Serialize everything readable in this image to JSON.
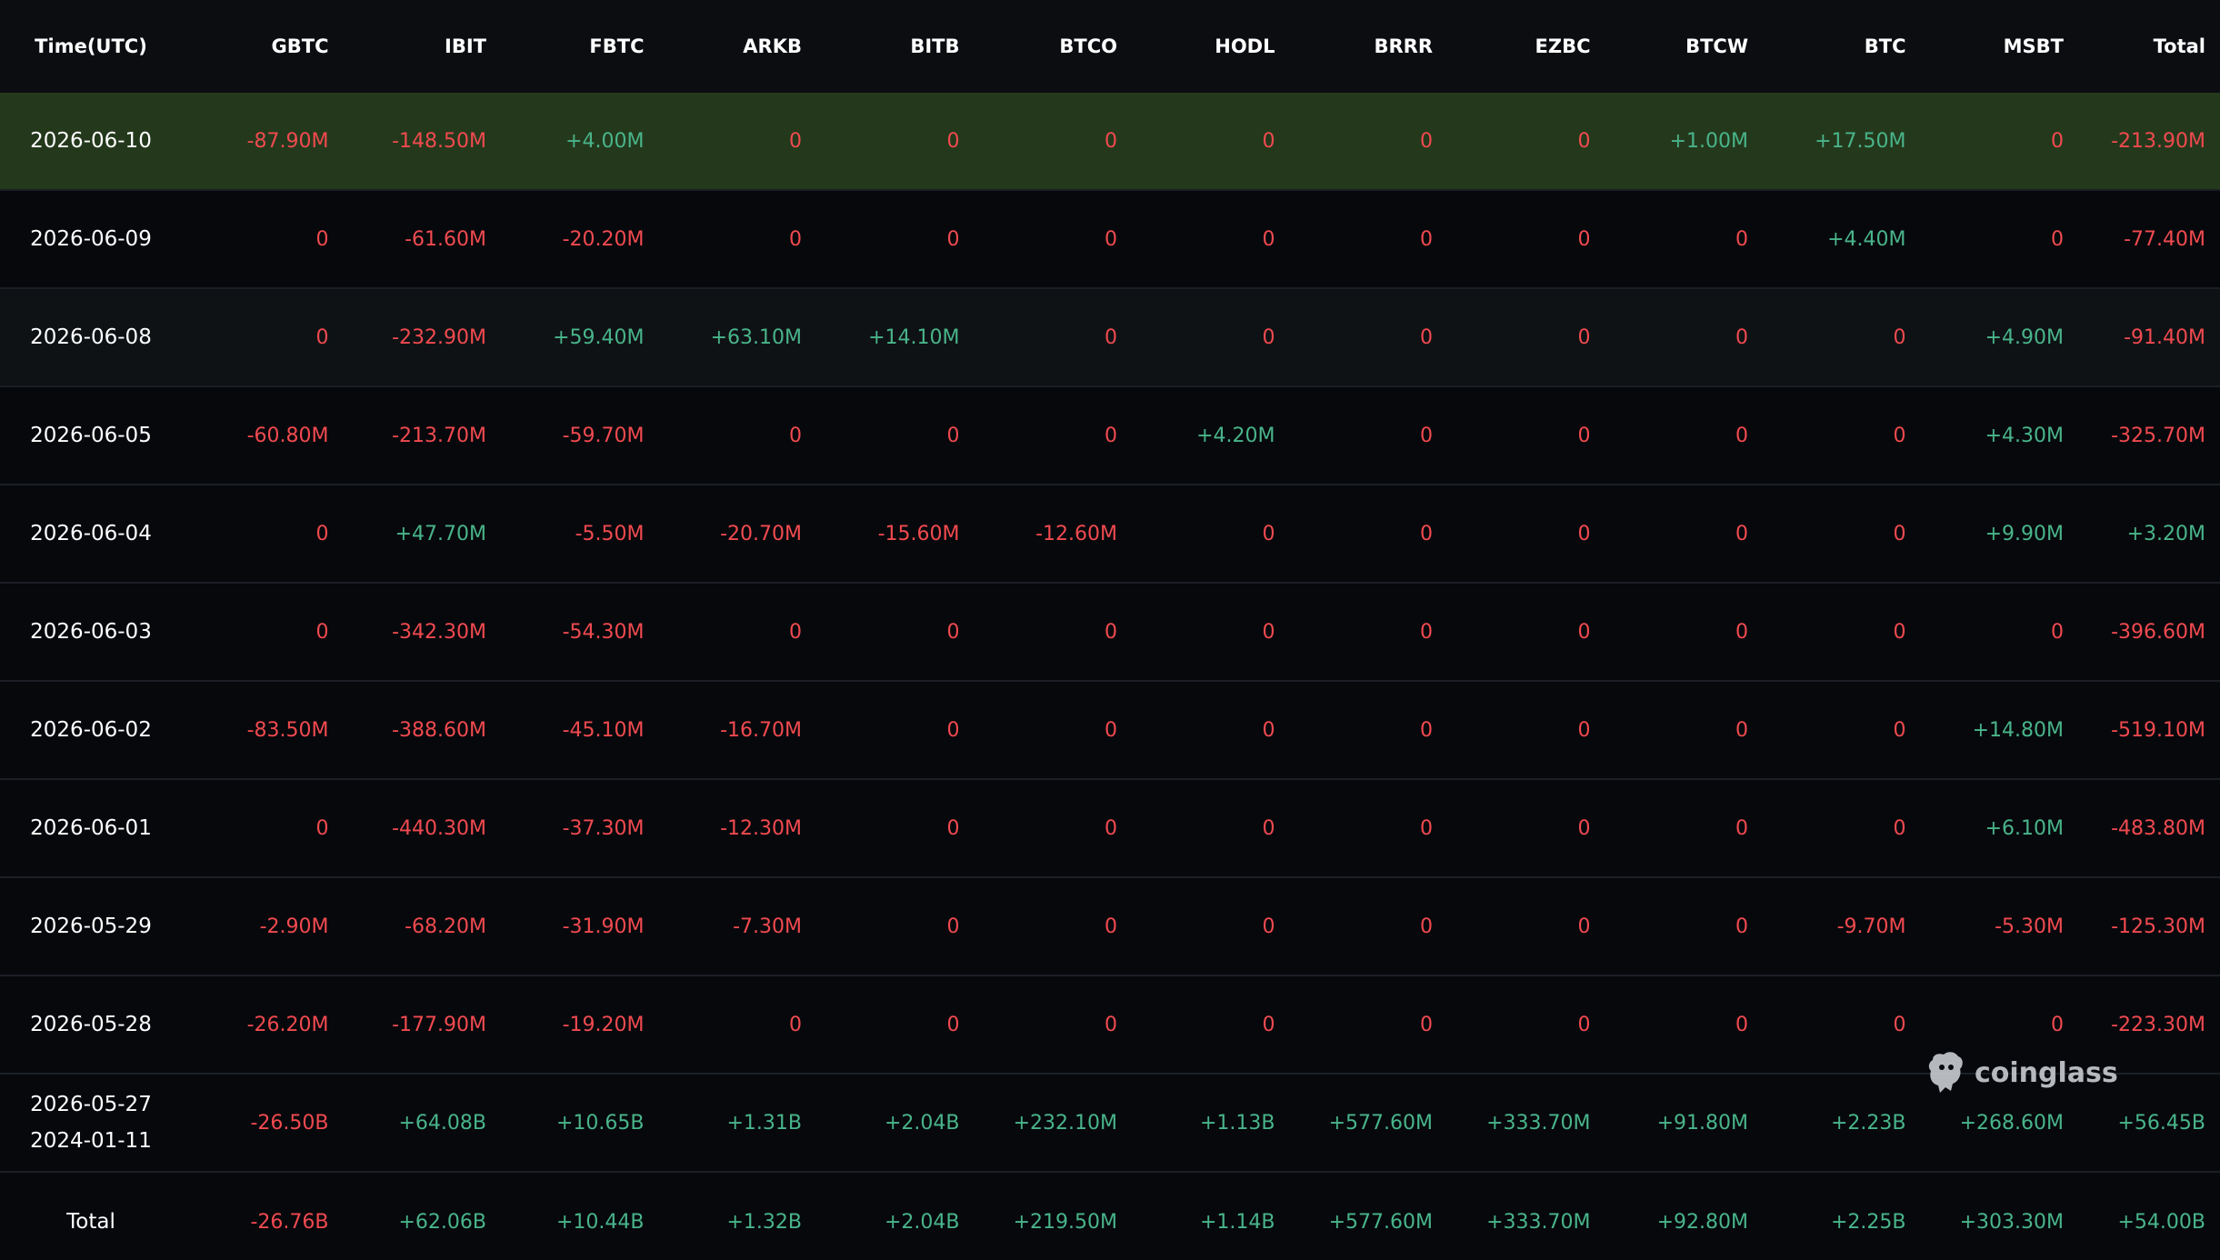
{
  "columns": [
    "Time(UTC)",
    "GBTC",
    "IBIT",
    "FBTC",
    "ARKB",
    "BITB",
    "BTCO",
    "HODL",
    "BRRR",
    "EZBC",
    "BTCW",
    "BTC",
    "MSBT",
    "Total"
  ],
  "rows": [
    {
      "time": "2026-06-10",
      "values": [
        "-87.90M",
        "-148.50M",
        "+4.00M",
        "0",
        "0",
        "0",
        "0",
        "0",
        "0",
        "+1.00M",
        "+17.50M",
        "0",
        "-213.90M"
      ]
    },
    {
      "time": "2026-06-09",
      "values": [
        "0",
        "-61.60M",
        "-20.20M",
        "0",
        "0",
        "0",
        "0",
        "0",
        "0",
        "0",
        "+4.40M",
        "0",
        "-77.40M"
      ]
    },
    {
      "time": "2026-06-08",
      "values": [
        "0",
        "-232.90M",
        "+59.40M",
        "+63.10M",
        "+14.10M",
        "0",
        "0",
        "0",
        "0",
        "0",
        "0",
        "+4.90M",
        "-91.40M"
      ]
    },
    {
      "time": "2026-06-05",
      "values": [
        "-60.80M",
        "-213.70M",
        "-59.70M",
        "0",
        "0",
        "0",
        "+4.20M",
        "0",
        "0",
        "0",
        "0",
        "+4.30M",
        "-325.70M"
      ]
    },
    {
      "time": "2026-06-04",
      "values": [
        "0",
        "+47.70M",
        "-5.50M",
        "-20.70M",
        "-15.60M",
        "-12.60M",
        "0",
        "0",
        "0",
        "0",
        "0",
        "+9.90M",
        "+3.20M"
      ]
    },
    {
      "time": "2026-06-03",
      "values": [
        "0",
        "-342.30M",
        "-54.30M",
        "0",
        "0",
        "0",
        "0",
        "0",
        "0",
        "0",
        "0",
        "0",
        "-396.60M"
      ]
    },
    {
      "time": "2026-06-02",
      "values": [
        "-83.50M",
        "-388.60M",
        "-45.10M",
        "-16.70M",
        "0",
        "0",
        "0",
        "0",
        "0",
        "0",
        "0",
        "+14.80M",
        "-519.10M"
      ]
    },
    {
      "time": "2026-06-01",
      "values": [
        "0",
        "-440.30M",
        "-37.30M",
        "-12.30M",
        "0",
        "0",
        "0",
        "0",
        "0",
        "0",
        "0",
        "+6.10M",
        "-483.80M"
      ]
    },
    {
      "time": "2026-05-29",
      "values": [
        "-2.90M",
        "-68.20M",
        "-31.90M",
        "-7.30M",
        "0",
        "0",
        "0",
        "0",
        "0",
        "0",
        "-9.70M",
        "-5.30M",
        "-125.30M"
      ]
    },
    {
      "time": "2026-05-28",
      "values": [
        "-26.20M",
        "-177.90M",
        "-19.20M",
        "0",
        "0",
        "0",
        "0",
        "0",
        "0",
        "0",
        "0",
        "0",
        "-223.30M"
      ]
    }
  ],
  "range_row": {
    "time_from": "2026-05-27",
    "time_to": "2024-01-11",
    "values": [
      "-26.50B",
      "+64.08B",
      "+10.65B",
      "+1.31B",
      "+2.04B",
      "+232.10M",
      "+1.13B",
      "+577.60M",
      "+333.70M",
      "+91.80M",
      "+2.23B",
      "+268.60M",
      "+56.45B"
    ]
  },
  "total_row": {
    "label": "Total",
    "values": [
      "-26.76B",
      "+62.06B",
      "+10.44B",
      "+1.32B",
      "+2.04B",
      "+219.50M",
      "+1.14B",
      "+577.60M",
      "+333.70M",
      "+92.80M",
      "+2.25B",
      "+303.30M",
      "+54.00B"
    ]
  },
  "watermark": {
    "text": "coinglass",
    "icon": "coinglass-logo-icon"
  },
  "colors": {
    "positive": "#49b48a",
    "negative": "#f04a4f",
    "highlight_row": "#24391c",
    "background": "#06080c"
  }
}
